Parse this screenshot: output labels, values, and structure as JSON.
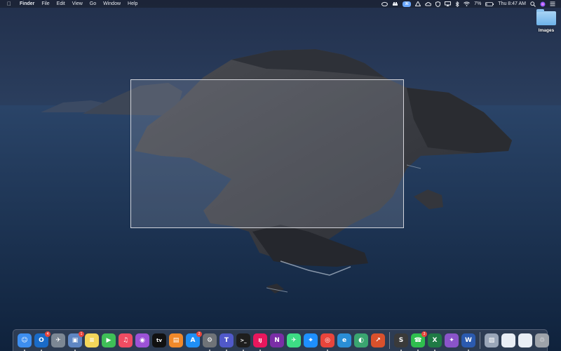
{
  "menubar": {
    "apple_icon": "apple-logo",
    "items": [
      "Finder",
      "File",
      "Edit",
      "View",
      "Go",
      "Window",
      "Help"
    ],
    "status": {
      "badge_text": "⌘",
      "battery": "7%",
      "clock": "Thu 8:47 AM"
    }
  },
  "desktop": {
    "icons": [
      {
        "label": "Images",
        "icon": "folder-icon"
      }
    ]
  },
  "dock": {
    "apps": [
      {
        "name": "Finder",
        "glyph": "☺",
        "color": "#3d8ef0",
        "running": true
      },
      {
        "name": "Outlook",
        "glyph": "O",
        "color": "#1a6bc7",
        "running": true,
        "badge": "4"
      },
      {
        "name": "Launchpad",
        "glyph": "✈",
        "color": "#7c8794",
        "running": false
      },
      {
        "name": "Preview",
        "glyph": "▣",
        "color": "#5f86c2",
        "running": true,
        "badge": "1"
      },
      {
        "name": "Notes",
        "glyph": "≡",
        "color": "#f3d65a",
        "running": false
      },
      {
        "name": "FaceTime",
        "glyph": "▶",
        "color": "#3fbf57",
        "running": false
      },
      {
        "name": "Music",
        "glyph": "♫",
        "color": "#f04c62",
        "running": false
      },
      {
        "name": "Podcasts",
        "glyph": "◉",
        "color": "#9c52d6",
        "running": false
      },
      {
        "name": "TV",
        "glyph": "tv",
        "color": "#111111",
        "running": false
      },
      {
        "name": "Books",
        "glyph": "▤",
        "color": "#f0892a",
        "running": false
      },
      {
        "name": "App Store",
        "glyph": "A",
        "color": "#1f8ff5",
        "running": false,
        "badge": "2"
      },
      {
        "name": "System Preferences",
        "glyph": "⚙",
        "color": "#6f7378",
        "running": true
      },
      {
        "name": "Teams",
        "glyph": "T",
        "color": "#5059c9",
        "running": true
      },
      {
        "name": "Terminal",
        "glyph": ">_",
        "color": "#1e1e1e",
        "running": true
      },
      {
        "name": "IntelliJ IDEA",
        "glyph": "IJ",
        "color": "#e8175d",
        "running": true
      },
      {
        "name": "OneNote",
        "glyph": "N",
        "color": "#7a2ea6",
        "running": false
      },
      {
        "name": "Android Studio",
        "glyph": "✈",
        "color": "#3ddc84",
        "running": false
      },
      {
        "name": "Safari",
        "glyph": "⌖",
        "color": "#1e90ff",
        "running": false
      },
      {
        "name": "Chrome",
        "glyph": "◎",
        "color": "#e8453c",
        "running": true
      },
      {
        "name": "Edge",
        "glyph": "e",
        "color": "#2a8ed6",
        "running": false
      },
      {
        "name": "Network Radar",
        "glyph": "◐",
        "color": "#3aa570",
        "running": false
      },
      {
        "name": "Remote Desktop",
        "glyph": "↗",
        "color": "#d9512c",
        "running": false
      },
      {
        "name": "Sublime Text",
        "glyph": "S",
        "color": "#3a3a3a",
        "running": true
      },
      {
        "name": "WhatsApp",
        "glyph": "☎",
        "color": "#2fbe4e",
        "running": true,
        "badge": "3"
      },
      {
        "name": "Excel",
        "glyph": "X",
        "color": "#1f7a45",
        "running": true
      },
      {
        "name": "Nova",
        "glyph": "✦",
        "color": "#8a54c9",
        "running": false
      },
      {
        "name": "Word",
        "glyph": "W",
        "color": "#2b5aaf",
        "running": true
      },
      {
        "name": "Screen Capture",
        "glyph": "▨",
        "color": "#9aa6b8",
        "running": false
      },
      {
        "name": "Window Thumbnail",
        "glyph": "",
        "color": "#e9eef5",
        "running": false
      },
      {
        "name": "Window Thumbnail 2",
        "glyph": "",
        "color": "#e9eef5",
        "running": false
      },
      {
        "name": "Trash",
        "glyph": "♲",
        "color": "#9ea3aa",
        "running": false
      }
    ]
  }
}
